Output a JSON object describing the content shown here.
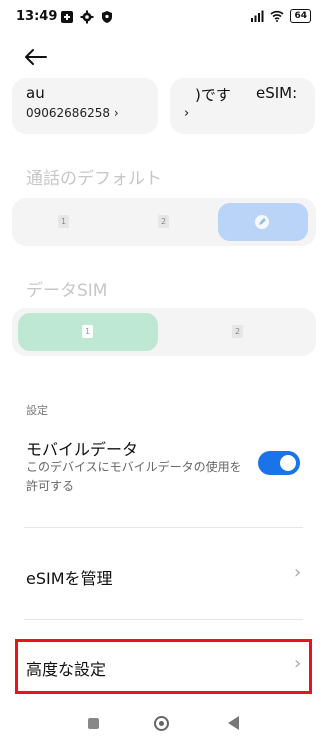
{
  "status": {
    "time": "13:49",
    "battery": "64"
  },
  "sims": [
    {
      "name": "au",
      "number": "09062686258",
      "chevron": "›"
    },
    {
      "name": "　)です",
      "name_tail": "eSIM:",
      "chevron": "›"
    }
  ],
  "call_default": {
    "title": "通話のデフォルト",
    "options": [
      "1",
      "2"
    ]
  },
  "data_sim": {
    "title": "データSIM",
    "options": [
      "1",
      "2"
    ]
  },
  "settings": {
    "label": "設定",
    "mobile_data": {
      "title": "モバイルデータ",
      "subtitle": "このデバイスにモバイルデータの使用を許可する",
      "enabled": true
    },
    "manage_esim": "eSIMを管理",
    "advanced": "高度な設定"
  },
  "colors": {
    "accent": "#1a73e8",
    "data_selected": "#bfe8d4",
    "call_selected": "#b9d4f6",
    "highlight": "#e8141c"
  }
}
